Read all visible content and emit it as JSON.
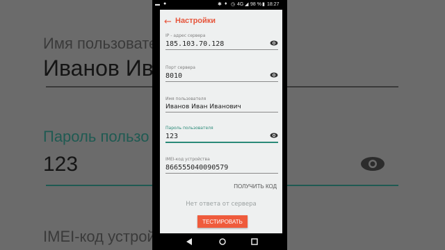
{
  "status_bar": {
    "network": "4G",
    "battery": "98 %",
    "time": "18:27"
  },
  "app": {
    "title": "Настройки"
  },
  "fields": {
    "server_ip": {
      "label": "IP - адрес сервера",
      "value": "185.103.70.128"
    },
    "server_port": {
      "label": "Порт сервера",
      "value": "8010"
    },
    "username": {
      "label": "Имя пользователя",
      "value": "Иванов Иван Иванович"
    },
    "password": {
      "label": "Пароль пользователя",
      "value": "123"
    },
    "imei": {
      "label": "IMEI-код устройства",
      "value": "866555040090579"
    }
  },
  "actions": {
    "get_code": "ПОЛУЧИТЬ КОД",
    "test": "ТЕСТИРОВАТЬ"
  },
  "status_message": "Нет ответа от сервера",
  "background": {
    "username_label": "Имя пользовател",
    "username_value": "Иванов Ив",
    "password_label": "Пароль пользо",
    "password_value": "123",
    "imei_label": "IMEI-код устрой"
  },
  "colors": {
    "accent": "#e6553b",
    "focus": "#2a8a78",
    "button": "#ef5b3c"
  }
}
